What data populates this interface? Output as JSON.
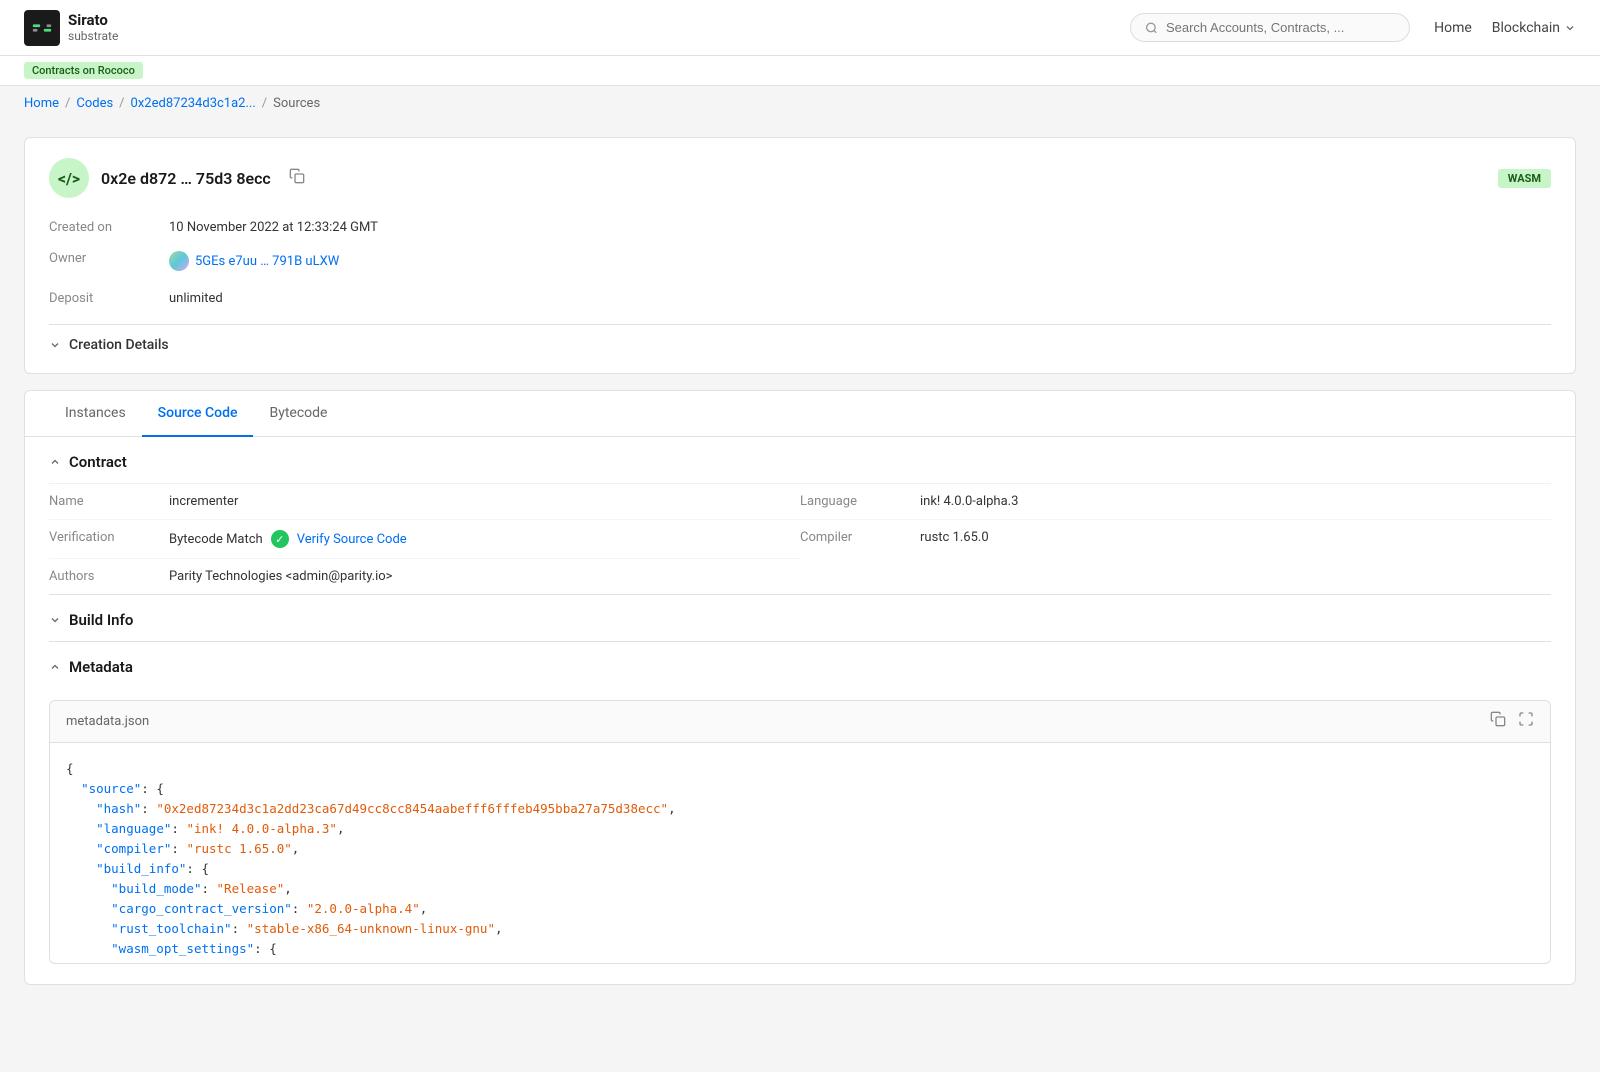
{
  "header": {
    "logo_name": "Sirato",
    "logo_sub": "substrate",
    "badge": "Contracts on Rococo",
    "search_placeholder": "Search Accounts, Contracts, ...",
    "nav": {
      "home": "Home",
      "blockchain": "Blockchain"
    }
  },
  "breadcrumb": {
    "home": "Home",
    "codes": "Codes",
    "hash_short": "0x2ed87234d3c1a2...",
    "current": "Sources"
  },
  "code_detail": {
    "hash_display": "0x2e d872 … 75d3 8ecc",
    "badge": "WASM",
    "created_on_label": "Created on",
    "created_on_value": "10 November 2022 at 12:33:24 GMT",
    "owner_label": "Owner",
    "owner_value": "5GEs e7uu … 791B uLXW",
    "deposit_label": "Deposit",
    "deposit_value": "unlimited",
    "creation_details_label": "Creation Details"
  },
  "tabs": {
    "instances": "Instances",
    "source_code": "Source Code",
    "bytecode": "Bytecode"
  },
  "contract": {
    "section_label": "Contract",
    "name_label": "Name",
    "name_value": "incrementer",
    "verification_label": "Verification",
    "verification_text": "Bytecode Match",
    "verify_link": "Verify Source Code",
    "authors_label": "Authors",
    "authors_value": "Parity Technologies <admin@parity.io>",
    "language_label": "Language",
    "language_value": "ink! 4.0.0-alpha.3",
    "compiler_label": "Compiler",
    "compiler_value": "rustc 1.65.0"
  },
  "build_info": {
    "section_label": "Build Info"
  },
  "metadata": {
    "section_label": "Metadata",
    "file_name": "metadata.json",
    "code": {
      "line1": "{",
      "line2": "  \"source\": {",
      "line3": "    \"hash\": \"0x2ed87234d3c1a2dd23ca67d49cc8cc8454aabefff6fffeb495bba27a75d38ecc\",",
      "line4": "    \"language\": \"ink! 4.0.0-alpha.3\",",
      "line5": "    \"compiler\": \"rustc 1.65.0\",",
      "line6": "    \"build_info\": {",
      "line7": "      \"build_mode\": \"Release\",",
      "line8": "      \"cargo_contract_version\": \"2.0.0-alpha.4\",",
      "line9": "      \"rust_toolchain\": \"stable-x86_64-unknown-linux-gnu\",",
      "line10": "      \"wasm_opt_settings\": {"
    }
  }
}
